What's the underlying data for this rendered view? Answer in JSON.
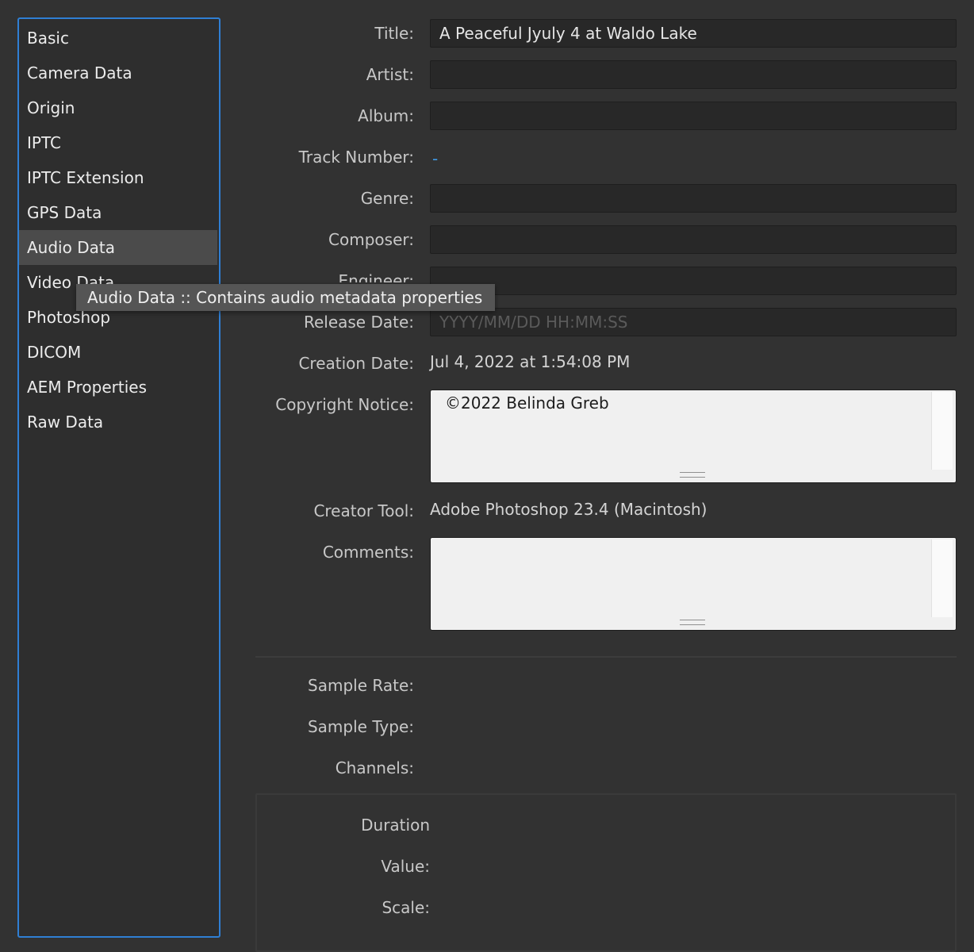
{
  "sidebar": {
    "items": [
      {
        "label": "Basic"
      },
      {
        "label": "Camera Data"
      },
      {
        "label": "Origin"
      },
      {
        "label": "IPTC"
      },
      {
        "label": "IPTC Extension"
      },
      {
        "label": "GPS Data"
      },
      {
        "label": "Audio Data",
        "selected": true
      },
      {
        "label": "Video Data"
      },
      {
        "label": "Photoshop"
      },
      {
        "label": "DICOM"
      },
      {
        "label": "AEM Properties"
      },
      {
        "label": "Raw Data"
      }
    ]
  },
  "tooltip": "Audio Data :: Contains audio metadata properties",
  "fields": {
    "title": {
      "label": "Title:",
      "value": "A Peaceful Jyuly 4 at Waldo Lake"
    },
    "artist": {
      "label": "Artist:",
      "value": ""
    },
    "album": {
      "label": "Album:",
      "value": ""
    },
    "track_number": {
      "label": "Track Number:",
      "value": "-"
    },
    "genre": {
      "label": "Genre:",
      "value": ""
    },
    "composer": {
      "label": "Composer:",
      "value": ""
    },
    "engineer": {
      "label": "Engineer:",
      "value": ""
    },
    "release_date": {
      "label": "Release Date:",
      "value": "",
      "placeholder": "YYYY/MM/DD HH:MM:SS"
    },
    "creation_date": {
      "label": "Creation Date:",
      "value": "Jul 4, 2022 at 1:54:08 PM"
    },
    "copyright_notice": {
      "label": "Copyright Notice:",
      "value": "©2022 Belinda Greb"
    },
    "creator_tool": {
      "label": "Creator Tool:",
      "value": "Adobe Photoshop 23.4 (Macintosh)"
    },
    "comments": {
      "label": "Comments:",
      "value": ""
    },
    "sample_rate": {
      "label": "Sample Rate:",
      "value": ""
    },
    "sample_type": {
      "label": "Sample Type:",
      "value": ""
    },
    "channels": {
      "label": "Channels:",
      "value": ""
    }
  },
  "duration_group": {
    "heading": "Duration",
    "value_label": "Value:",
    "scale_label": "Scale:"
  },
  "colors": {
    "background": "#323232",
    "sidebar_border": "#2f7fd4",
    "selection": "#4b4b4b",
    "link": "#3f9be8",
    "tooltip_bg": "#555555"
  }
}
